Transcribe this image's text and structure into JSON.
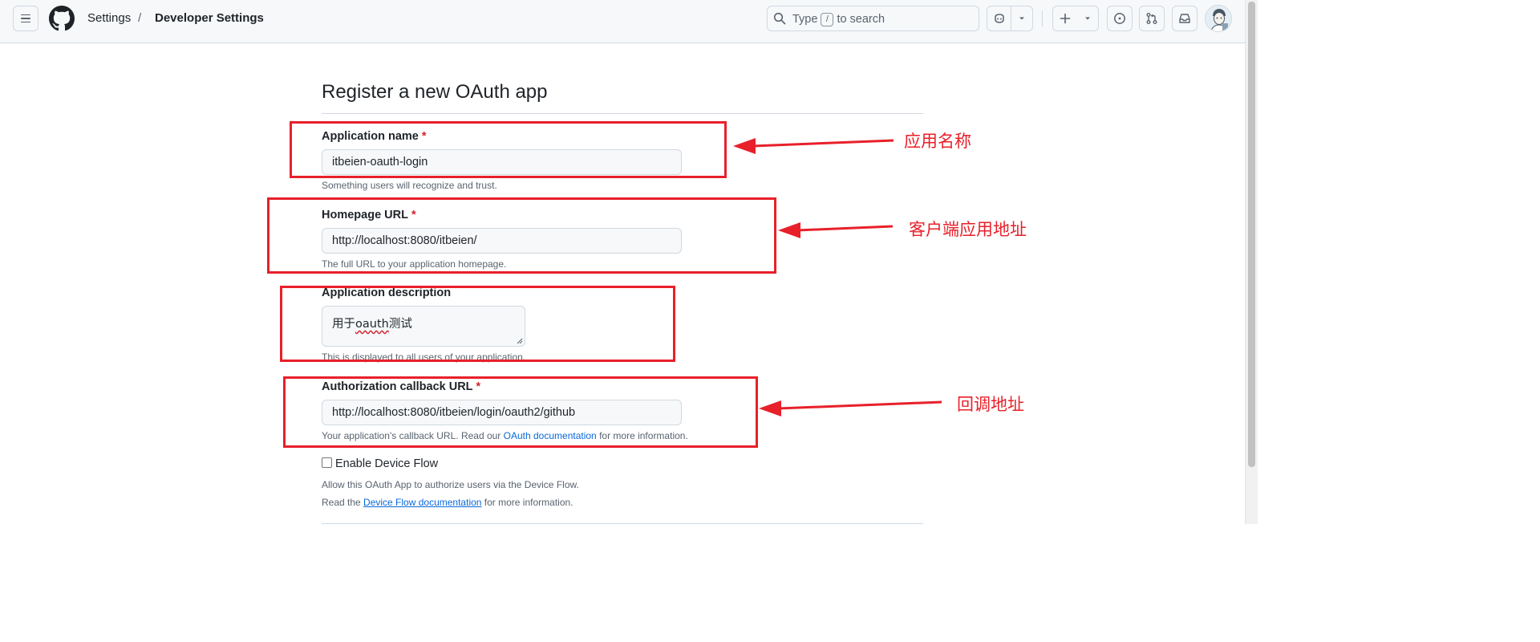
{
  "header": {
    "breadcrumb": [
      "Settings",
      "Developer Settings"
    ],
    "separator": "/",
    "search": {
      "prefix": "Type",
      "key": "/",
      "suffix": "to search"
    }
  },
  "form": {
    "title": "Register a new OAuth app",
    "app_name": {
      "label": "Application name",
      "required_mark": "*",
      "value": "itbeien-oauth-login",
      "note": "Something users will recognize and trust."
    },
    "homepage": {
      "label": "Homepage URL",
      "required_mark": "*",
      "value": "http://localhost:8080/itbeien/",
      "note": "The full URL to your application homepage."
    },
    "description": {
      "label": "Application description",
      "value_prefix": "用于",
      "value_misspelled": "oauth",
      "value_suffix": "测试",
      "note": "This is displayed to all users of your application."
    },
    "callback": {
      "label": "Authorization callback URL",
      "required_mark": "*",
      "value": "http://localhost:8080/itbeien/login/oauth2/github",
      "note_before": "Your application's callback URL. Read our",
      "note_link": "OAuth documentation",
      "note_after": "for more information."
    },
    "device_flow": {
      "label": "Enable Device Flow",
      "checked": false,
      "note1": "Allow this OAuth App to authorize users via the Device Flow.",
      "note2_before": "Read the",
      "note2_link": "Device Flow documentation",
      "note2_after": "for more information."
    }
  },
  "annotations": {
    "app_name": "应用名称",
    "homepage": "客户端应用地址",
    "callback": "回调地址"
  },
  "colors": {
    "annotation_red": "#e8202a",
    "link_blue": "#0969da",
    "required_red": "#d1242f"
  },
  "icons": [
    "hamburger-icon",
    "github-logo-icon",
    "search-icon",
    "copilot-icon",
    "chevron-down-icon",
    "plus-icon",
    "issues-icon",
    "pull-request-icon",
    "inbox-icon",
    "avatar"
  ]
}
